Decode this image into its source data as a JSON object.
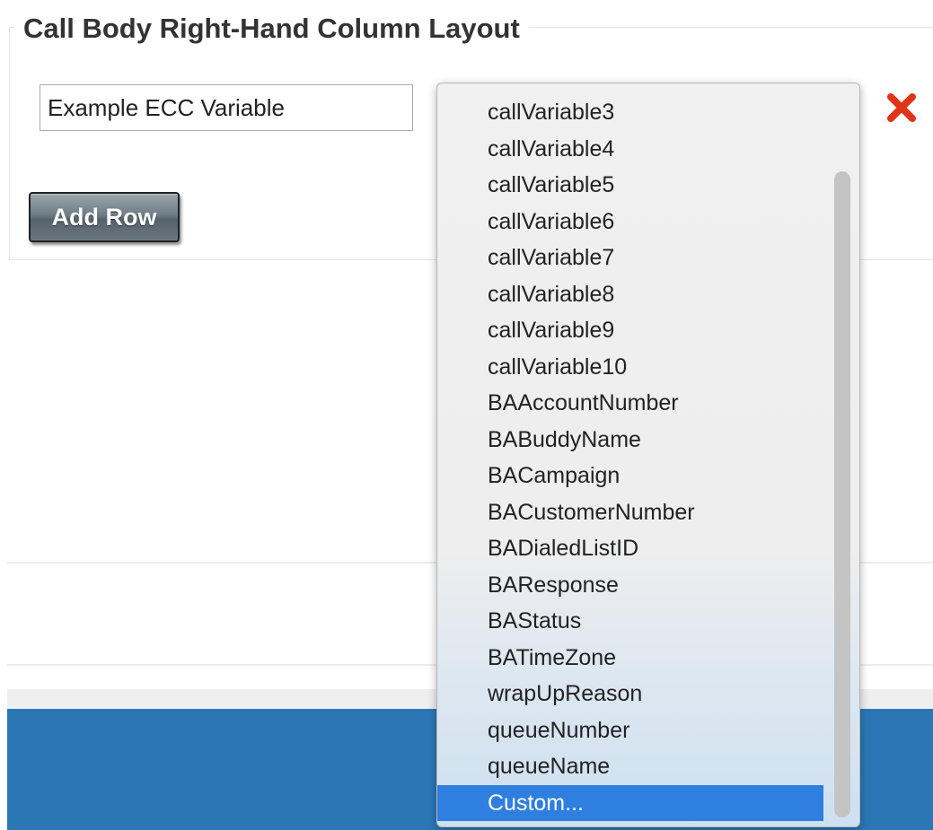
{
  "section": {
    "title": "Call Body Right-Hand Column Layout"
  },
  "row": {
    "label_value": "Example ECC Variable",
    "remove_icon": "red-x-icon"
  },
  "actions": {
    "add_row_label": "Add Row"
  },
  "dropdown": {
    "options": [
      "callVariable3",
      "callVariable4",
      "callVariable5",
      "callVariable6",
      "callVariable7",
      "callVariable8",
      "callVariable9",
      "callVariable10",
      "BAAccountNumber",
      "BABuddyName",
      "BACampaign",
      "BACustomerNumber",
      "BADialedListID",
      "BAResponse",
      "BAStatus",
      "BATimeZone",
      "wrapUpReason",
      "queueNumber",
      "queueName",
      "Custom..."
    ],
    "selected": "Custom..."
  },
  "colors": {
    "accent_blue": "#2b77b5",
    "selection_blue": "#2f7fe0",
    "remove_red": "#e0341a"
  }
}
